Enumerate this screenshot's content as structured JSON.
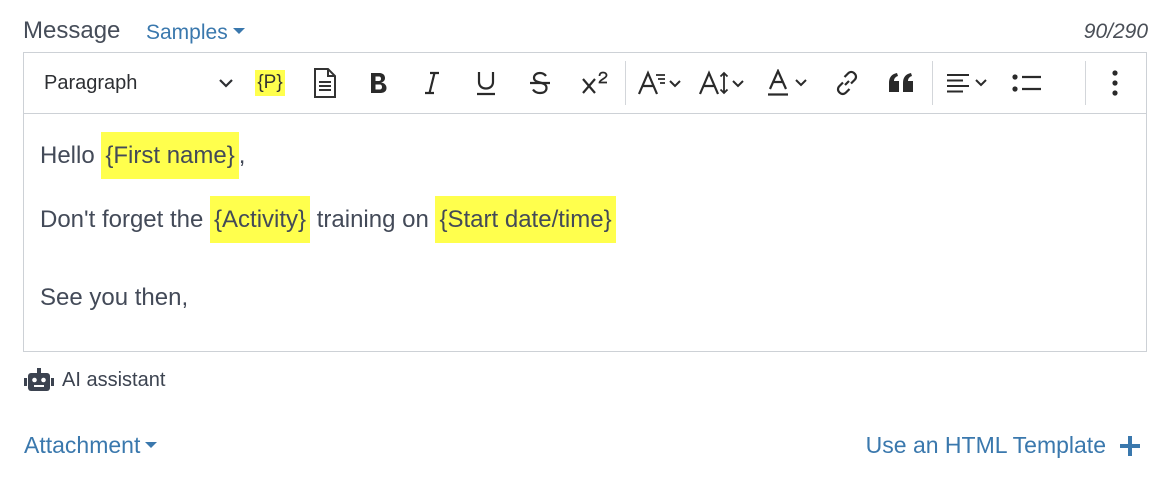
{
  "header": {
    "label": "Message",
    "samples_label": "Samples",
    "counter": "90/290"
  },
  "toolbar": {
    "block_format": "Paragraph",
    "placeholder_tag": "{P}"
  },
  "content": {
    "line1": {
      "prefix": "Hello ",
      "field": "{First name}",
      "suffix": ","
    },
    "line2": {
      "prefix": "Don't forget the ",
      "field1": "{Activity}",
      "middle": " training on ",
      "field2": "{Start date/time}"
    },
    "line3": "See you then,"
  },
  "ai_assistant": "AI assistant",
  "attachment_label": "Attachment",
  "html_template_label": "Use an HTML Template",
  "colors": {
    "link": "#3a78ad",
    "highlight": "#ffff4d",
    "border": "#cdd1d6"
  }
}
